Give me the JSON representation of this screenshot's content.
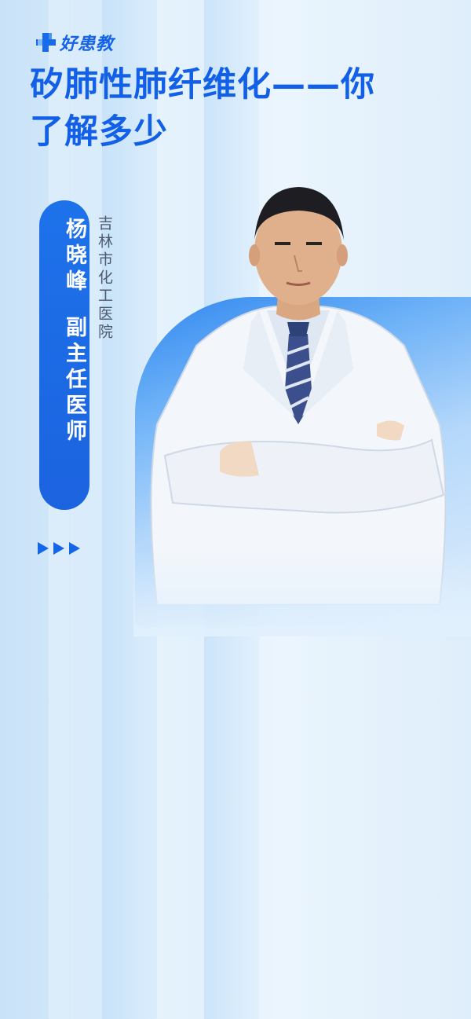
{
  "brand": {
    "name": "好患教",
    "color": "#1463e6"
  },
  "title": {
    "line1": "矽肺性肺纤维化——你",
    "line2": "了解多少"
  },
  "doctor": {
    "name": "杨晓峰",
    "position": "副主任医师",
    "hospital": "吉林市化工医院"
  },
  "icons": {
    "logo": "medical-cross-icon",
    "arrows": "play-arrow-icon"
  }
}
